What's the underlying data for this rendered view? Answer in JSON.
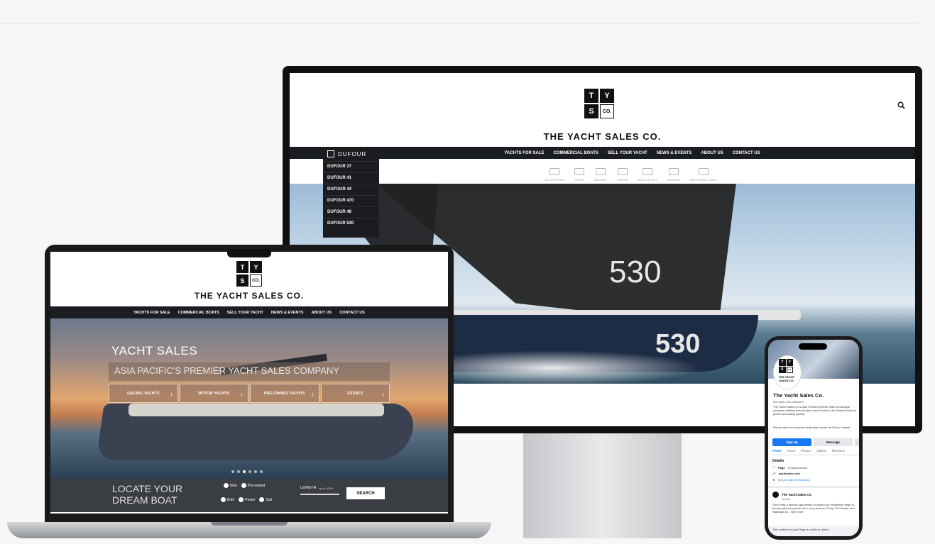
{
  "brand": {
    "name": "THE YACHT SALES CO.",
    "logo_letters": [
      "T",
      "Y",
      "S",
      "CO."
    ]
  },
  "monitor": {
    "nav": [
      "YACHTS FOR SALE",
      "COMMERCIAL BOATS",
      "SELL YOUR YACHT",
      "NEWS & EVENTS",
      "ABOUT US",
      "CONTACT US"
    ],
    "subnav": [
      "DESCRIPTION",
      "SPECS",
      "GALLERY",
      "VIDEOS",
      "BOAT LAYOUT",
      "REVIEWS",
      "BROCHURE & INFO"
    ],
    "dropdown_brand": "DUFOUR",
    "dropdown_items": [
      "DUFOUR 37",
      "DUFOUR 41",
      "DUFOUR 44",
      "DUFOUR 470",
      "DUFOUR 48",
      "DUFOUR 530"
    ],
    "sail_number": "530",
    "hull_number": "530"
  },
  "laptop": {
    "nav": [
      "YACHTS FOR SALE",
      "COMMERCIAL BOATS",
      "SELL YOUR YACHT",
      "NEWS & EVENTS",
      "ABOUT US",
      "CONTACT US"
    ],
    "hero_title": "YACHT SALES",
    "hero_tagline": "ASIA PACIFIC'S PREMIER YACHT SALES COMPANY",
    "hero_buttons": [
      "SAILING YACHTS",
      "MOTOR YACHTS",
      "PRE-OWNED YACHTS",
      "EVENTS"
    ],
    "search": {
      "title": "LOCATE YOUR DREAM BOAT",
      "condition_options": [
        "New",
        "Pre-owned"
      ],
      "type_options": [
        "Both",
        "Power",
        "Sail"
      ],
      "length_label": "LENGTH",
      "length_range": "up to 100 ft",
      "button": "SEARCH"
    }
  },
  "phone": {
    "page_name": "The Yacht Sales Co.",
    "stats": "500 likes • 861 followers",
    "description": "The Yacht Sales Co is Asia Pacific's premier yacht brokerage company offering new and pre-owned sales of the finest brands of power and sailing yachts.",
    "description2": "We are also the exclusive Australian dealer for Dufour Yachts.",
    "buttons": [
      "Sign Up",
      "Message",
      "…"
    ],
    "tabs": [
      "Posts",
      "About",
      "Photos",
      "Videos",
      "Mentions"
    ],
    "details_title": "Details",
    "details": {
      "page_label": "Page",
      "page_type": "Product/service",
      "website": "yachtsales.com",
      "rating": "Not yet rated (3 Reviews)"
    },
    "post_author": "The Yacht Sales Co.",
    "post_meta": "Sunday",
    "post_body": "Don't miss a special opportunity to inspect an expansive range of famous @dufouryachts all in one place on Friday 25 October and Saturday 26... See more",
    "footer": "This content on your Page is visible to others"
  }
}
